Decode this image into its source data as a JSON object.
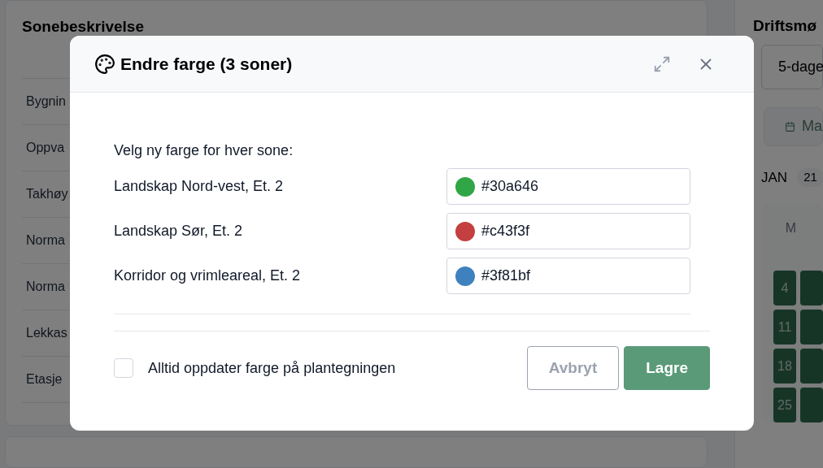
{
  "zone_panel": {
    "title": "Sonebeskrivelse",
    "rows": [
      {
        "label": "Bygnin"
      },
      {
        "label": "Oppva"
      },
      {
        "label": "Takhøy"
      },
      {
        "label": "Norma"
      },
      {
        "label": "Norma"
      },
      {
        "label": "Lekkas"
      },
      {
        "label": "Etasje"
      }
    ]
  },
  "schedule_panel": {
    "title": "Driftsmø",
    "select_value": "5-dage",
    "button_label": "Ma",
    "month": "JAN",
    "week_badge": "21",
    "weekday": "M",
    "days": [
      "4",
      "11",
      "18",
      "25"
    ]
  },
  "dialog": {
    "title": "Endre farge (3 soner)",
    "instruction": "Velg ny farge for hver sone:",
    "zones": [
      {
        "name": "Landskap Nord-vest, Et. 2",
        "value": "#30a646",
        "color": "#30a646"
      },
      {
        "name": "Landskap Sør, Et. 2",
        "value": "#c43f3f",
        "color": "#c43f3f"
      },
      {
        "name": "Korridor og vrimleareal, Et. 2",
        "value": "#3f81bf",
        "color": "#3f81bf"
      }
    ],
    "always_update": {
      "label": "Alltid oppdater farge på plantegningen",
      "checked": false
    },
    "buttons": [
      {
        "label": "Avbryt",
        "kind": "secondary"
      },
      {
        "label": "Lagre",
        "kind": "primary"
      }
    ]
  }
}
